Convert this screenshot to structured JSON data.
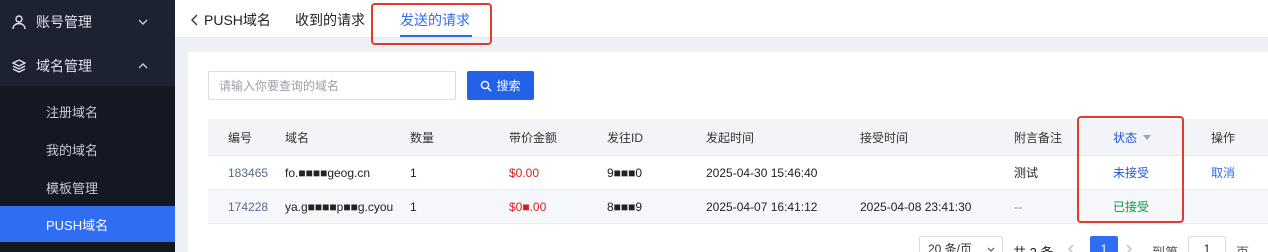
{
  "sidebar": {
    "groups": [
      {
        "label": "账号管理",
        "icon": "user-icon"
      },
      {
        "label": "域名管理",
        "icon": "layers-icon"
      }
    ],
    "items": [
      {
        "label": "注册域名"
      },
      {
        "label": "我的域名"
      },
      {
        "label": "模板管理"
      },
      {
        "label": "PUSH域名",
        "active": true
      }
    ]
  },
  "topbar": {
    "back_label": "PUSH域名",
    "tabs": [
      {
        "label": "收到的请求"
      },
      {
        "label": "发送的请求",
        "active": true
      }
    ]
  },
  "search": {
    "placeholder": "请输入你要查询的域名",
    "button_label": "搜索"
  },
  "table": {
    "headers": [
      "编号",
      "域名",
      "数量",
      "带价金额",
      "发往ID",
      "发起时间",
      "接受时间",
      "附言备注",
      "状态",
      "操作"
    ],
    "rows": [
      {
        "id": "183465",
        "domain": "fo.■■■■geog.cn",
        "qty": "1",
        "price": "$0.00",
        "target_id": "9■■■0",
        "start_time": "2025-04-30 15:46:40",
        "accept_time": "",
        "note": "测试",
        "status": "未接受",
        "action": "取消"
      },
      {
        "id": "174228",
        "domain": "ya.g■■■■p■■g.cyou",
        "qty": "1",
        "price": "$0■.00",
        "target_id": "8■■■9",
        "start_time": "2025-04-07 16:41:12",
        "accept_time": "2025-04-08 23:41:30",
        "note": "--",
        "status": "已接受",
        "action": ""
      }
    ]
  },
  "pagination": {
    "page_size": "20 条/页",
    "total": "共 2 条",
    "current_page": "1",
    "goto_label": "到第",
    "goto_value": "1",
    "page_unit": "页"
  },
  "colors": {
    "accent": "#2f6df2",
    "sidebar_bg": "#1d2231",
    "highlight": "#e23b2e",
    "price": "#d81e1e",
    "status_pending": "#1f55d6",
    "status_accepted": "#0a9a3a"
  }
}
